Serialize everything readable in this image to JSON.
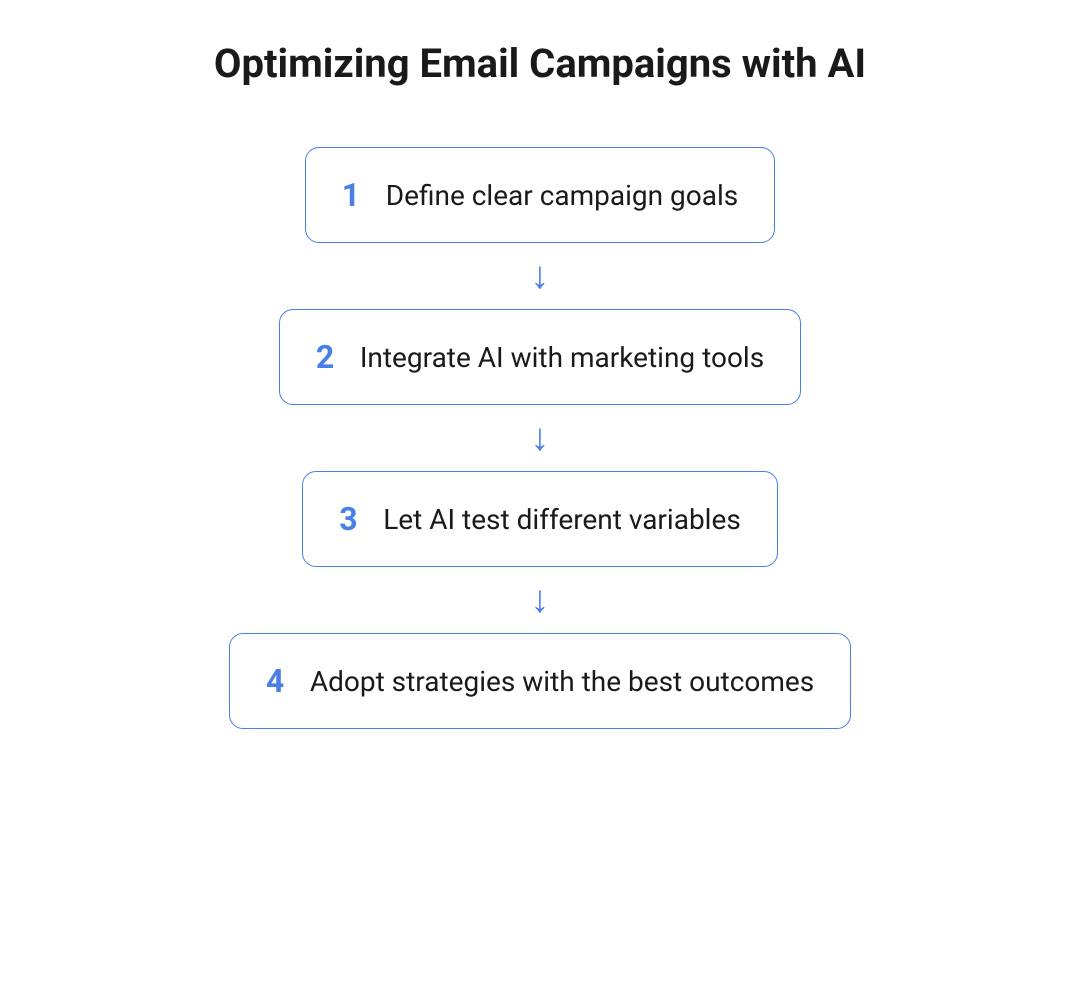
{
  "title": "Optimizing Email Campaigns with AI",
  "steps": [
    {
      "number": "1",
      "text": "Define clear campaign goals"
    },
    {
      "number": "2",
      "text": "Integrate AI with marketing tools"
    },
    {
      "number": "3",
      "text": "Let AI test different variables"
    },
    {
      "number": "4",
      "text": "Adopt strategies with the best outcomes"
    }
  ],
  "colors": {
    "accent": "#4a7fe8",
    "text": "#1a1a1a"
  }
}
